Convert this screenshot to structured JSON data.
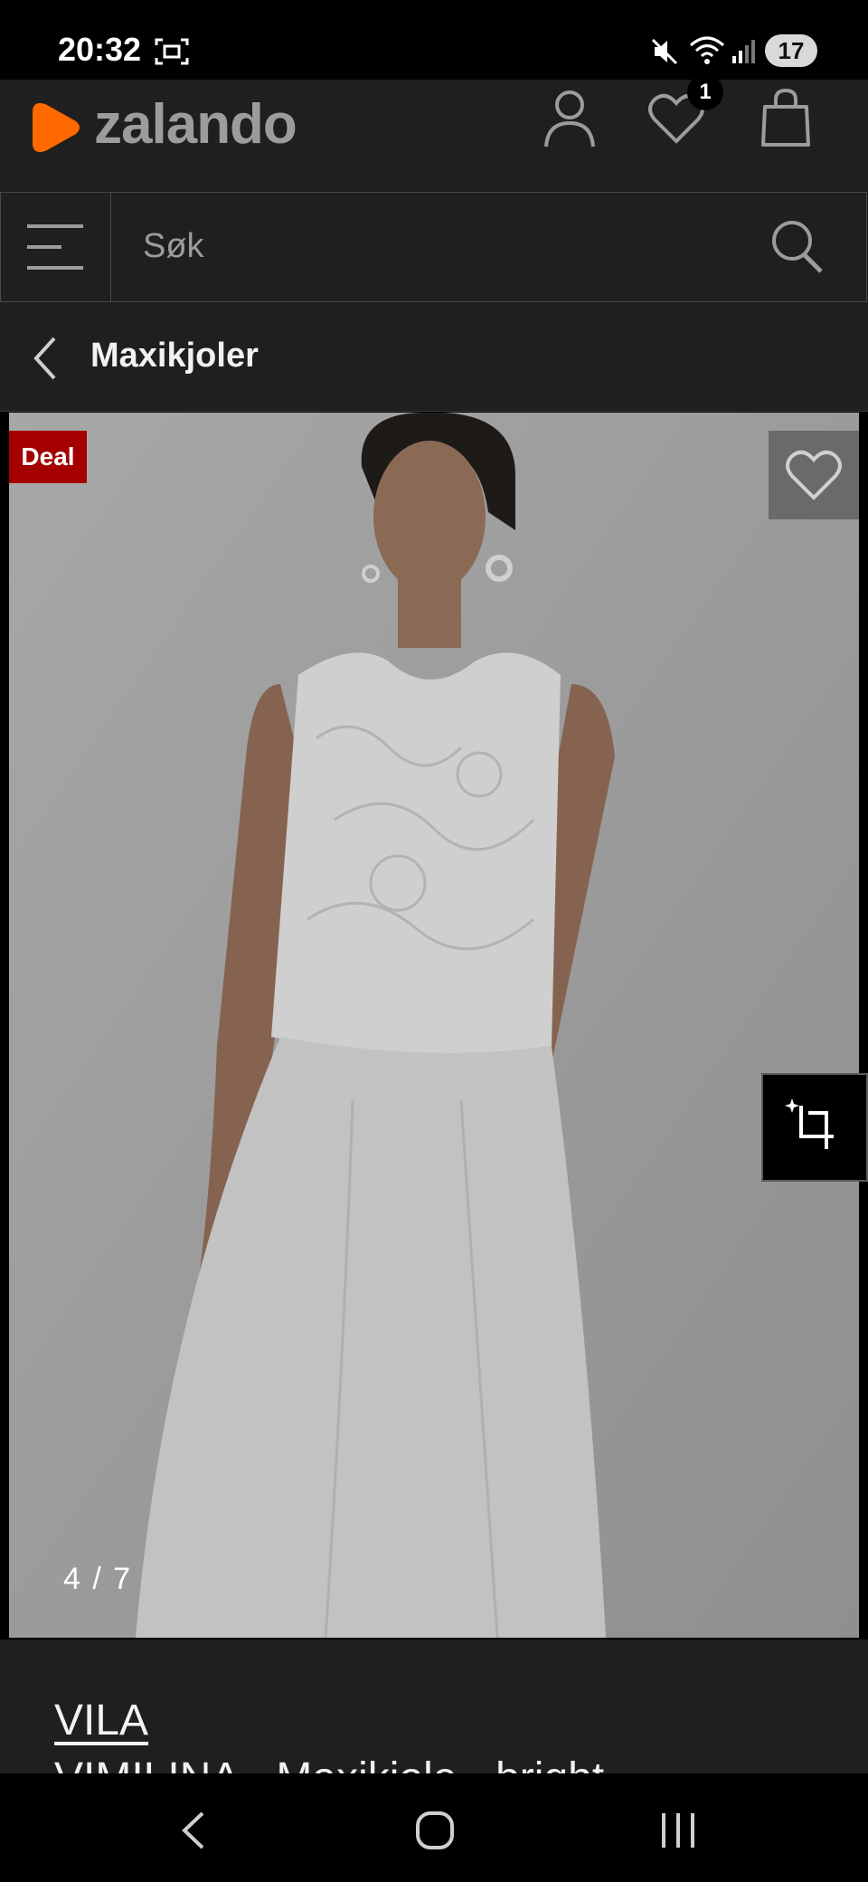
{
  "status_bar": {
    "time": "20:32",
    "battery": "17",
    "icons": [
      "screenshot-icon",
      "mute-icon",
      "wifi-icon",
      "signal-icon"
    ]
  },
  "header": {
    "brand": "zalando",
    "wishlist_count": "1",
    "icons": [
      "account-icon",
      "heart-icon",
      "bag-icon"
    ]
  },
  "search": {
    "placeholder": "Søk"
  },
  "breadcrumb": {
    "title": "Maxikjoler"
  },
  "gallery": {
    "deal_label": "Deal",
    "pager": "4 / 7"
  },
  "product": {
    "brand": "VILA",
    "name": "VIMILINA - Maxikjole - bright"
  },
  "colors": {
    "accent": "#ff6900",
    "deal": "#a40000",
    "background": "#1f1f1f"
  }
}
